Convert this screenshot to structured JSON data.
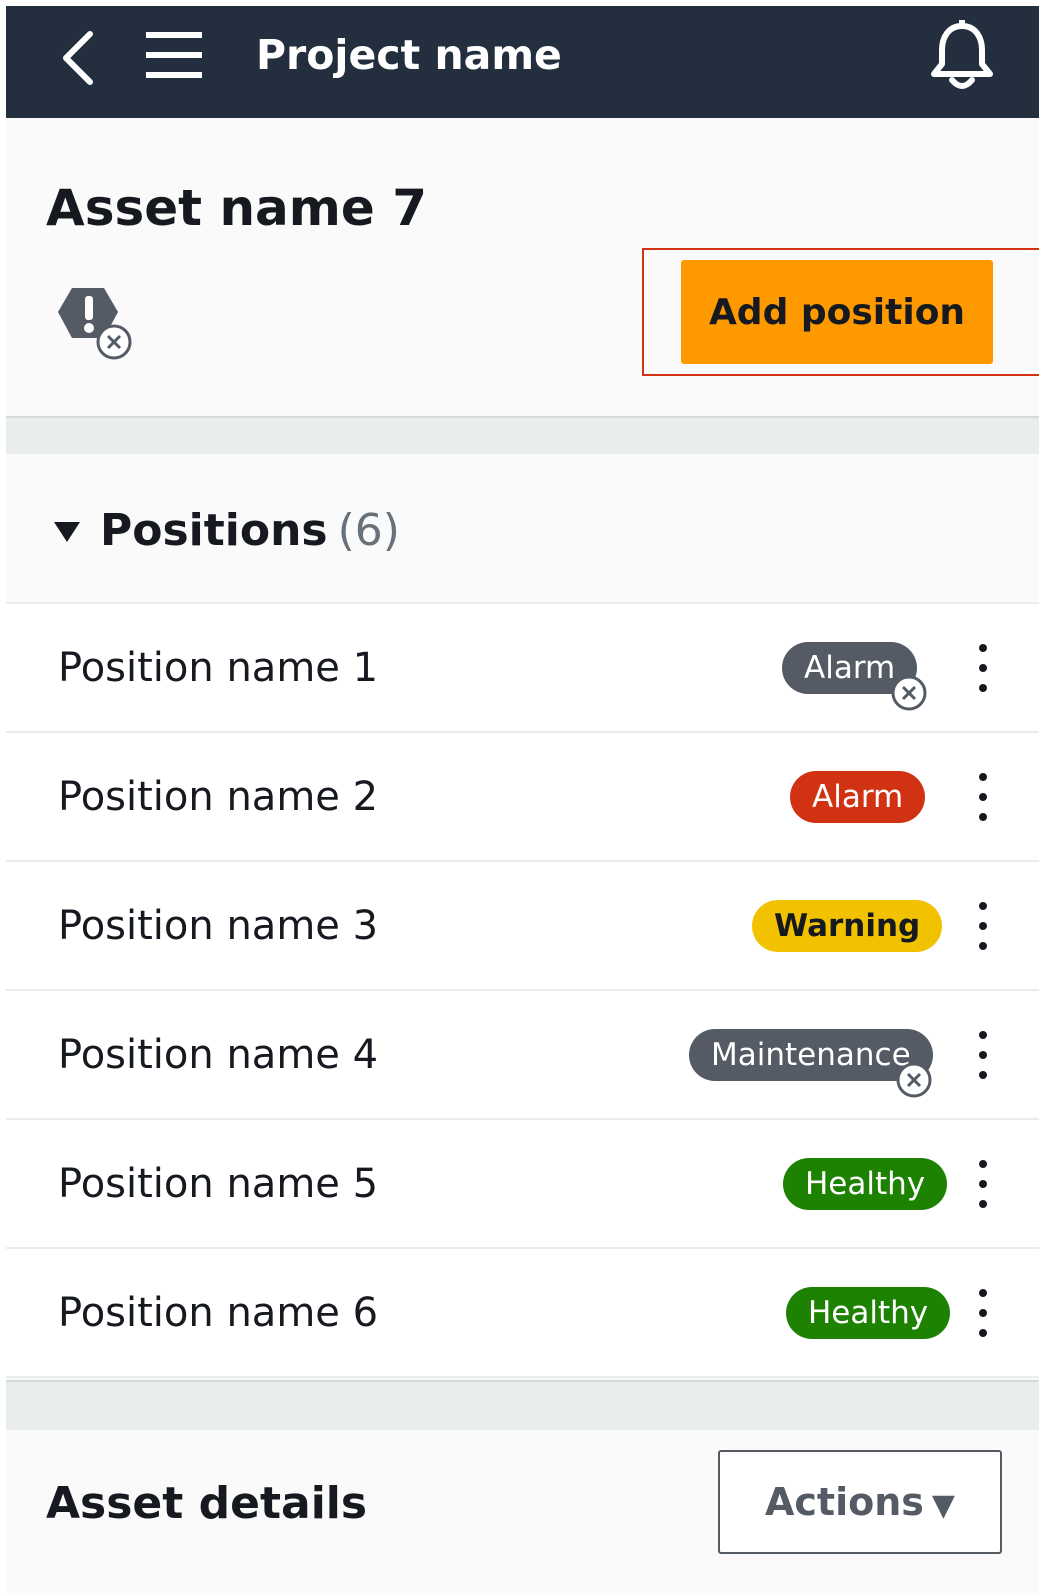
{
  "topbar": {
    "title": "Project name",
    "back_icon": "chevron-left-icon",
    "menu_icon": "hamburger-icon",
    "bell_icon": "bell-icon"
  },
  "asset": {
    "title": "Asset name 7",
    "status_icon": "warning-octagon-with-x-icon",
    "add_position_label": "Add position"
  },
  "positions": {
    "title": "Positions",
    "count": "(6)",
    "items": [
      {
        "name": "Position name 1",
        "status": "Alarm",
        "variant": "grey",
        "disabled_marker": true
      },
      {
        "name": "Position name 2",
        "status": "Alarm",
        "variant": "red",
        "disabled_marker": false
      },
      {
        "name": "Position name 3",
        "status": "Warning",
        "variant": "yellow",
        "disabled_marker": false
      },
      {
        "name": "Position name 4",
        "status": "Maintenance",
        "variant": "grey",
        "disabled_marker": true
      },
      {
        "name": "Position name 5",
        "status": "Healthy",
        "variant": "green",
        "disabled_marker": false
      },
      {
        "name": "Position name 6",
        "status": "Healthy",
        "variant": "green",
        "disabled_marker": false
      }
    ]
  },
  "details": {
    "title": "Asset details",
    "actions_label": "Actions"
  },
  "colors": {
    "topbar_bg": "#232f3e",
    "primary_button": "#ff9900",
    "alarm_red": "#d13212",
    "warning_yellow": "#f2c200",
    "healthy_green": "#1d8102",
    "grey_badge": "#545b64",
    "highlight_border": "#d13212"
  }
}
